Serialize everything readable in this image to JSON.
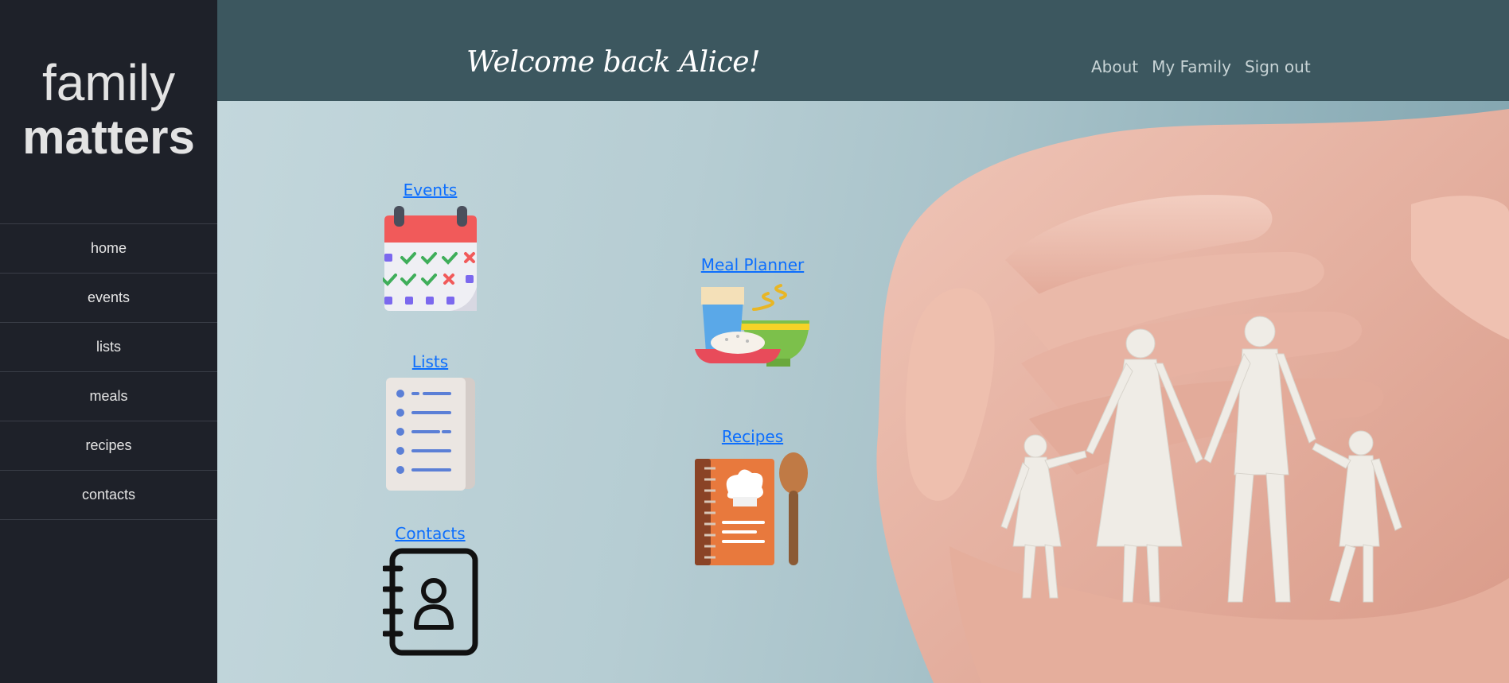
{
  "sidebar": {
    "logo_line1": "family",
    "logo_line2": "matters",
    "items": [
      {
        "label": "home"
      },
      {
        "label": "events"
      },
      {
        "label": "lists"
      },
      {
        "label": "meals"
      },
      {
        "label": "recipes"
      },
      {
        "label": "contacts"
      }
    ]
  },
  "header": {
    "welcome": "Welcome back Alice!",
    "links": [
      {
        "label": "About"
      },
      {
        "label": "My Family"
      },
      {
        "label": "Sign out"
      }
    ]
  },
  "tiles": {
    "events": {
      "label": "Events",
      "icon": "calendar-icon"
    },
    "lists": {
      "label": "Lists",
      "icon": "checklist-icon"
    },
    "contacts": {
      "label": "Contacts",
      "icon": "address-book-icon"
    },
    "meal_planner": {
      "label": "Meal Planner",
      "icon": "meal-icon"
    },
    "recipes": {
      "label": "Recipes",
      "icon": "recipe-book-icon"
    }
  },
  "colors": {
    "sidebar_bg": "#1e2129",
    "header_bg": "#3c575f",
    "link": "#0d6efd"
  }
}
